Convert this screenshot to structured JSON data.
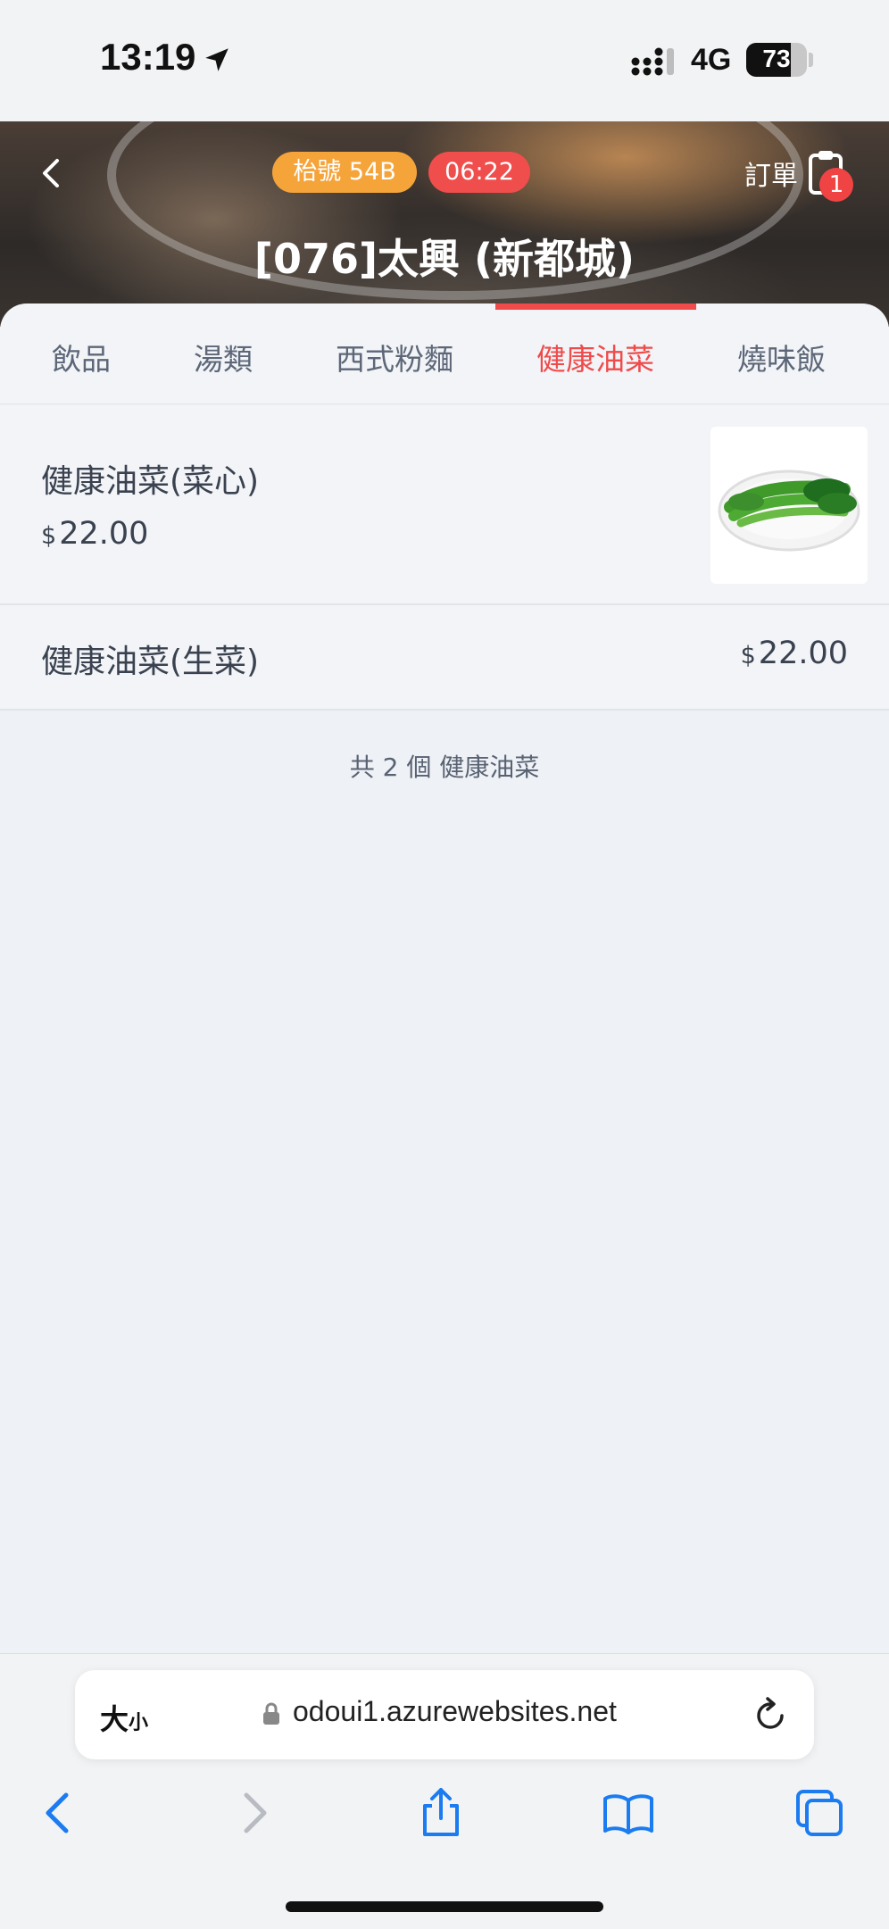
{
  "status_bar": {
    "time": "13:19",
    "network": "4G",
    "battery": "73",
    "battery_level": 0.73
  },
  "header": {
    "table_label": "枱號  54B",
    "timer": "06:22",
    "order_label": "訂單",
    "order_count": "1",
    "shop_title": "[076]太興 (新都城)"
  },
  "tabs": [
    {
      "label": "飲品"
    },
    {
      "label": "湯類"
    },
    {
      "label": "西式粉麵"
    },
    {
      "label": "健康油菜",
      "active": true
    },
    {
      "label": "燒味飯"
    }
  ],
  "items": [
    {
      "name": "健康油菜(菜心)",
      "currency": "$",
      "price": "22.00",
      "has_image": true
    },
    {
      "name": "健康油菜(生菜)",
      "currency": "$",
      "price": "22.00",
      "has_image": false
    }
  ],
  "summary": "共 2 個 健康油菜",
  "browser": {
    "text_size_label_big": "大",
    "text_size_label_small": "小",
    "url": "odoui1.azurewebsites.net"
  },
  "colors": {
    "accent": "#ef4b4b",
    "table_pill": "#f5a43a",
    "browser_blue": "#1a7cf0"
  },
  "icons": [
    "location-arrow-icon",
    "signal-icon",
    "battery-icon",
    "back-chevron-icon",
    "clipboard-icon",
    "lock-icon",
    "reload-icon",
    "nav-back-icon",
    "nav-forward-icon",
    "share-icon",
    "bookmarks-icon",
    "tabs-icon"
  ]
}
